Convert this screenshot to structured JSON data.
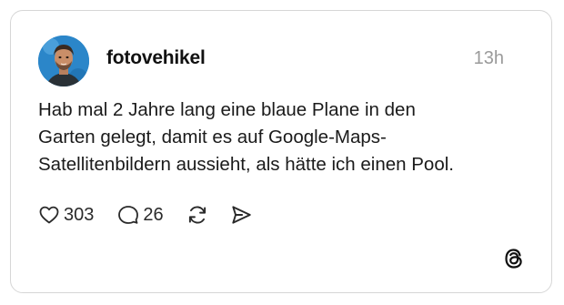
{
  "post": {
    "username": "fotovehikel",
    "time": "13h",
    "text_lines": [
      "Hab mal 2 Jahre lang eine blaue Plane in den",
      "Garten gelegt, damit es auf Google-Maps-",
      "Satellitenbildern aussieht, als hätte ich einen Pool."
    ],
    "likes": "303",
    "replies": "26"
  },
  "icons": {
    "like": "heart-icon",
    "reply": "comment-icon",
    "repost": "repost-icon",
    "share": "send-icon",
    "brand": "threads-logo-icon"
  },
  "colors": {
    "avatar_background": "#2b86c9",
    "border": "#d6d6d6",
    "timestamp": "#9a9a9a"
  }
}
